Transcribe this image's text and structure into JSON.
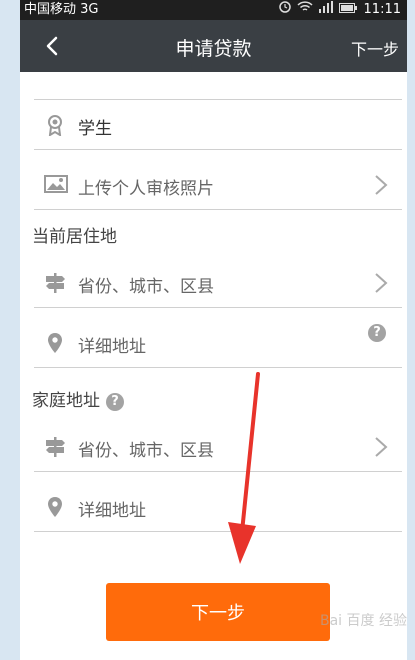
{
  "status_bar": {
    "carrier": "中国移动 3G",
    "time": "11:11"
  },
  "nav": {
    "title": "申请贷款",
    "next_label": "下一步"
  },
  "fields": {
    "identity_value": "学生",
    "upload_photo_label": "上传个人审核照片",
    "current_region_placeholder": "省份、城市、区县",
    "current_address_placeholder": "详细地址",
    "home_region_placeholder": "省份、城市、区县",
    "home_address_placeholder": "详细地址"
  },
  "sections": {
    "current_residence": "当前居住地",
    "home_address": "家庭地址"
  },
  "help_mark": "?",
  "primary_button": {
    "label": "下一步"
  },
  "watermark": "Bai 百度 经验",
  "colors": {
    "accent_orange": "#ff6b0b",
    "navbar": "#3a3f44",
    "annotation_red": "#e8332b"
  }
}
